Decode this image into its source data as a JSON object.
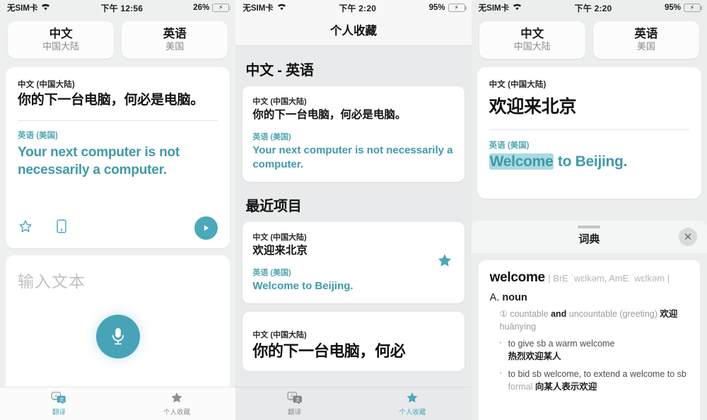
{
  "panels": [
    {
      "status": {
        "carrier": "无SIM卡",
        "time": "下午 12:56",
        "battery_pct": "26%",
        "wifi_icon": "wifi-icon",
        "battery_icon": "battery-charging-icon"
      },
      "source_lang": {
        "name": "中文",
        "region": "中国大陆"
      },
      "target_lang": {
        "name": "英语",
        "region": "美国"
      },
      "card": {
        "source_label": "中文 (中国大陆)",
        "source_text": "你的下一台电脑，何必是电脑。",
        "target_label": "英语 (美国)",
        "target_text": "Your next computer is not necessarily a computer.",
        "favorite_icon": "star-outline-icon",
        "dictionary_icon": "book-icon",
        "play_icon": "play-icon"
      },
      "input": {
        "placeholder": "输入文本",
        "mic_icon": "microphone-icon"
      },
      "tabs": [
        {
          "label": "翻译",
          "icon": "translate-icon",
          "active": true
        },
        {
          "label": "个人收藏",
          "icon": "star-filled-icon",
          "active": false
        }
      ]
    },
    {
      "status": {
        "carrier": "无SIM卡",
        "time": "下午 2:20",
        "battery_pct": "95%",
        "wifi_icon": "wifi-icon",
        "battery_icon": "battery-charging-icon"
      },
      "nav_title": "个人收藏",
      "pair_heading": "中文 - 英语",
      "favorite": {
        "source_label": "中文 (中国大陆)",
        "source_text": "你的下一台电脑，何必是电脑。",
        "target_label": "英语 (美国)",
        "target_text": "Your next computer is not necessarily a computer."
      },
      "recent_heading": "最近项目",
      "recents": [
        {
          "source_label": "中文 (中国大陆)",
          "source_text": "欢迎来北京",
          "target_label": "英语 (美国)",
          "target_text": "Welcome to Beijing.",
          "starred": true,
          "star_icon": "star-filled-icon"
        },
        {
          "source_label": "中文 (中国大陆)",
          "source_text": "你的下一台电脑，何必",
          "target_label": "",
          "target_text": "",
          "starred": false,
          "star_icon": "star-filled-icon"
        }
      ],
      "tabs": [
        {
          "label": "翻译",
          "icon": "translate-icon",
          "active": false
        },
        {
          "label": "个人收藏",
          "icon": "star-filled-icon",
          "active": true
        }
      ]
    },
    {
      "status": {
        "carrier": "无SIM卡",
        "time": "下午 2:20",
        "battery_pct": "95%",
        "wifi_icon": "wifi-icon",
        "battery_icon": "battery-charging-icon"
      },
      "source_lang": {
        "name": "中文",
        "region": "中国大陆"
      },
      "target_lang": {
        "name": "英语",
        "region": "美国"
      },
      "card": {
        "source_label": "中文 (中国大陆)",
        "source_text": "欢迎来北京",
        "target_label": "英语 (美国)",
        "target_highlighted": "Welcome",
        "target_rest": " to Beijing."
      },
      "dictionary": {
        "sheet_title": "词典",
        "close_icon": "close-icon",
        "word": "welcome",
        "phonetics": "| BrE ˈwɛlkəm, AmE ˈwɛlkəm |",
        "pos_letter": "A.",
        "pos": "noun",
        "sense_number": "①",
        "sense_grammar_1": "countable",
        "sense_and": "and",
        "sense_grammar_2": "uncountable",
        "sense_context": "(greeting)",
        "sense_cn": "欢迎",
        "sense_pinyin": "huānyíng",
        "examples": [
          {
            "en": "to give sb a warm welcome",
            "cn": "热烈欢迎某人",
            "register": ""
          },
          {
            "en": "to bid sb welcome, to extend a welcome to sb",
            "cn": "向某人表示欢迎",
            "register": "formal"
          }
        ]
      }
    }
  ],
  "colors": {
    "accent": "#4aa9bb",
    "teal_text": "#3f9aa8",
    "highlight": "#a9dae4",
    "battery_green": "#3cd152"
  }
}
